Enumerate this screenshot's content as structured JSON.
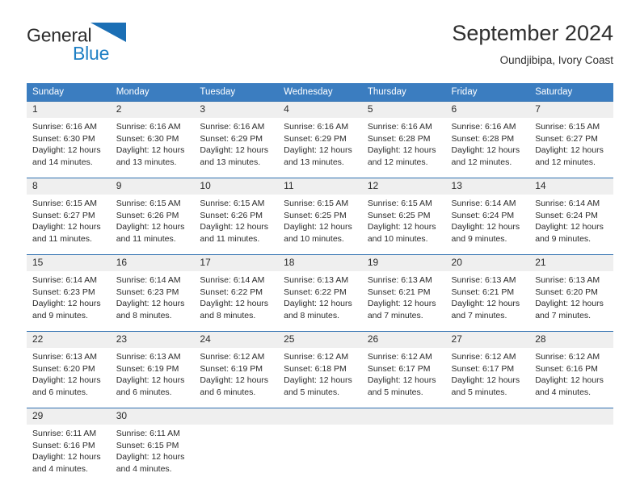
{
  "brand": {
    "name_top": "General",
    "name_bottom": "Blue",
    "triangle_color": "#1b6fb5",
    "text_color": "#2b2b2b",
    "blue_color": "#1e7fc4",
    "icon": "triangle-logo-icon"
  },
  "header": {
    "title": "September 2024",
    "subtitle": "Oundjibipa, Ivory Coast"
  },
  "theme": {
    "header_bar": "#3b7dc0",
    "row_divider": "#2f6fb0",
    "daynum_band": "#efefef",
    "text": "#2b2b2b"
  },
  "weekdays": [
    "Sunday",
    "Monday",
    "Tuesday",
    "Wednesday",
    "Thursday",
    "Friday",
    "Saturday"
  ],
  "weeks": [
    [
      {
        "day": "1",
        "sunrise": "Sunrise: 6:16 AM",
        "sunset": "Sunset: 6:30 PM",
        "daylight1": "Daylight: 12 hours",
        "daylight2": "and 14 minutes."
      },
      {
        "day": "2",
        "sunrise": "Sunrise: 6:16 AM",
        "sunset": "Sunset: 6:30 PM",
        "daylight1": "Daylight: 12 hours",
        "daylight2": "and 13 minutes."
      },
      {
        "day": "3",
        "sunrise": "Sunrise: 6:16 AM",
        "sunset": "Sunset: 6:29 PM",
        "daylight1": "Daylight: 12 hours",
        "daylight2": "and 13 minutes."
      },
      {
        "day": "4",
        "sunrise": "Sunrise: 6:16 AM",
        "sunset": "Sunset: 6:29 PM",
        "daylight1": "Daylight: 12 hours",
        "daylight2": "and 13 minutes."
      },
      {
        "day": "5",
        "sunrise": "Sunrise: 6:16 AM",
        "sunset": "Sunset: 6:28 PM",
        "daylight1": "Daylight: 12 hours",
        "daylight2": "and 12 minutes."
      },
      {
        "day": "6",
        "sunrise": "Sunrise: 6:16 AM",
        "sunset": "Sunset: 6:28 PM",
        "daylight1": "Daylight: 12 hours",
        "daylight2": "and 12 minutes."
      },
      {
        "day": "7",
        "sunrise": "Sunrise: 6:15 AM",
        "sunset": "Sunset: 6:27 PM",
        "daylight1": "Daylight: 12 hours",
        "daylight2": "and 12 minutes."
      }
    ],
    [
      {
        "day": "8",
        "sunrise": "Sunrise: 6:15 AM",
        "sunset": "Sunset: 6:27 PM",
        "daylight1": "Daylight: 12 hours",
        "daylight2": "and 11 minutes."
      },
      {
        "day": "9",
        "sunrise": "Sunrise: 6:15 AM",
        "sunset": "Sunset: 6:26 PM",
        "daylight1": "Daylight: 12 hours",
        "daylight2": "and 11 minutes."
      },
      {
        "day": "10",
        "sunrise": "Sunrise: 6:15 AM",
        "sunset": "Sunset: 6:26 PM",
        "daylight1": "Daylight: 12 hours",
        "daylight2": "and 11 minutes."
      },
      {
        "day": "11",
        "sunrise": "Sunrise: 6:15 AM",
        "sunset": "Sunset: 6:25 PM",
        "daylight1": "Daylight: 12 hours",
        "daylight2": "and 10 minutes."
      },
      {
        "day": "12",
        "sunrise": "Sunrise: 6:15 AM",
        "sunset": "Sunset: 6:25 PM",
        "daylight1": "Daylight: 12 hours",
        "daylight2": "and 10 minutes."
      },
      {
        "day": "13",
        "sunrise": "Sunrise: 6:14 AM",
        "sunset": "Sunset: 6:24 PM",
        "daylight1": "Daylight: 12 hours",
        "daylight2": "and 9 minutes."
      },
      {
        "day": "14",
        "sunrise": "Sunrise: 6:14 AM",
        "sunset": "Sunset: 6:24 PM",
        "daylight1": "Daylight: 12 hours",
        "daylight2": "and 9 minutes."
      }
    ],
    [
      {
        "day": "15",
        "sunrise": "Sunrise: 6:14 AM",
        "sunset": "Sunset: 6:23 PM",
        "daylight1": "Daylight: 12 hours",
        "daylight2": "and 9 minutes."
      },
      {
        "day": "16",
        "sunrise": "Sunrise: 6:14 AM",
        "sunset": "Sunset: 6:23 PM",
        "daylight1": "Daylight: 12 hours",
        "daylight2": "and 8 minutes."
      },
      {
        "day": "17",
        "sunrise": "Sunrise: 6:14 AM",
        "sunset": "Sunset: 6:22 PM",
        "daylight1": "Daylight: 12 hours",
        "daylight2": "and 8 minutes."
      },
      {
        "day": "18",
        "sunrise": "Sunrise: 6:13 AM",
        "sunset": "Sunset: 6:22 PM",
        "daylight1": "Daylight: 12 hours",
        "daylight2": "and 8 minutes."
      },
      {
        "day": "19",
        "sunrise": "Sunrise: 6:13 AM",
        "sunset": "Sunset: 6:21 PM",
        "daylight1": "Daylight: 12 hours",
        "daylight2": "and 7 minutes."
      },
      {
        "day": "20",
        "sunrise": "Sunrise: 6:13 AM",
        "sunset": "Sunset: 6:21 PM",
        "daylight1": "Daylight: 12 hours",
        "daylight2": "and 7 minutes."
      },
      {
        "day": "21",
        "sunrise": "Sunrise: 6:13 AM",
        "sunset": "Sunset: 6:20 PM",
        "daylight1": "Daylight: 12 hours",
        "daylight2": "and 7 minutes."
      }
    ],
    [
      {
        "day": "22",
        "sunrise": "Sunrise: 6:13 AM",
        "sunset": "Sunset: 6:20 PM",
        "daylight1": "Daylight: 12 hours",
        "daylight2": "and 6 minutes."
      },
      {
        "day": "23",
        "sunrise": "Sunrise: 6:13 AM",
        "sunset": "Sunset: 6:19 PM",
        "daylight1": "Daylight: 12 hours",
        "daylight2": "and 6 minutes."
      },
      {
        "day": "24",
        "sunrise": "Sunrise: 6:12 AM",
        "sunset": "Sunset: 6:19 PM",
        "daylight1": "Daylight: 12 hours",
        "daylight2": "and 6 minutes."
      },
      {
        "day": "25",
        "sunrise": "Sunrise: 6:12 AM",
        "sunset": "Sunset: 6:18 PM",
        "daylight1": "Daylight: 12 hours",
        "daylight2": "and 5 minutes."
      },
      {
        "day": "26",
        "sunrise": "Sunrise: 6:12 AM",
        "sunset": "Sunset: 6:17 PM",
        "daylight1": "Daylight: 12 hours",
        "daylight2": "and 5 minutes."
      },
      {
        "day": "27",
        "sunrise": "Sunrise: 6:12 AM",
        "sunset": "Sunset: 6:17 PM",
        "daylight1": "Daylight: 12 hours",
        "daylight2": "and 5 minutes."
      },
      {
        "day": "28",
        "sunrise": "Sunrise: 6:12 AM",
        "sunset": "Sunset: 6:16 PM",
        "daylight1": "Daylight: 12 hours",
        "daylight2": "and 4 minutes."
      }
    ],
    [
      {
        "day": "29",
        "sunrise": "Sunrise: 6:11 AM",
        "sunset": "Sunset: 6:16 PM",
        "daylight1": "Daylight: 12 hours",
        "daylight2": "and 4 minutes."
      },
      {
        "day": "30",
        "sunrise": "Sunrise: 6:11 AM",
        "sunset": "Sunset: 6:15 PM",
        "daylight1": "Daylight: 12 hours",
        "daylight2": "and 4 minutes."
      },
      {
        "day": "",
        "sunrise": "",
        "sunset": "",
        "daylight1": "",
        "daylight2": ""
      },
      {
        "day": "",
        "sunrise": "",
        "sunset": "",
        "daylight1": "",
        "daylight2": ""
      },
      {
        "day": "",
        "sunrise": "",
        "sunset": "",
        "daylight1": "",
        "daylight2": ""
      },
      {
        "day": "",
        "sunrise": "",
        "sunset": "",
        "daylight1": "",
        "daylight2": ""
      },
      {
        "day": "",
        "sunrise": "",
        "sunset": "",
        "daylight1": "",
        "daylight2": ""
      }
    ]
  ]
}
